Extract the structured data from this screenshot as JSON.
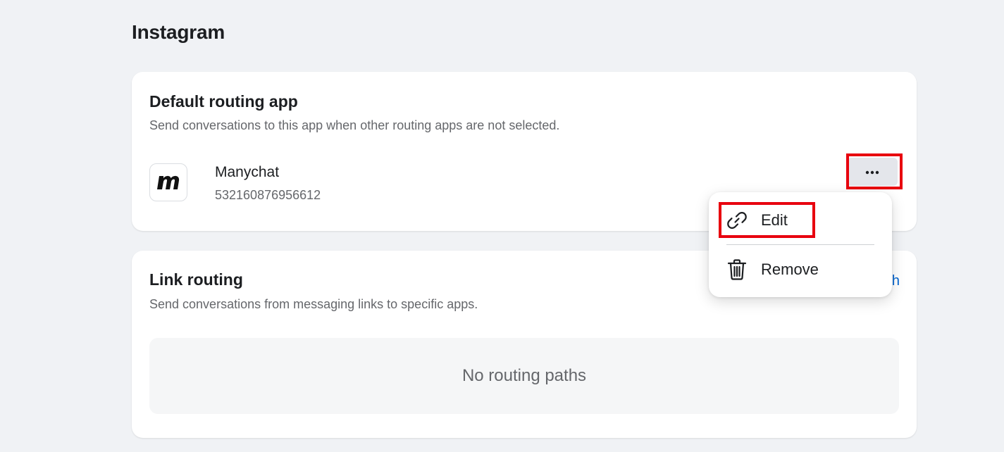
{
  "page": {
    "section_title": "Instagram"
  },
  "default_routing": {
    "title": "Default routing app",
    "description": "Send conversations to this app when other routing apps are not selected.",
    "app": {
      "name": "Manychat",
      "id": "532160876956612",
      "logo_icon": "manychat-logo"
    },
    "more_icon": "ellipsis-icon"
  },
  "link_routing": {
    "title": "Link routing",
    "description": "Send conversations from messaging links to specific apps.",
    "partial_action_label": "h",
    "empty_state": "No routing paths"
  },
  "dropdown_menu": {
    "items": [
      {
        "label": "Edit",
        "icon": "link-icon"
      },
      {
        "label": "Remove",
        "icon": "trash-icon"
      }
    ]
  },
  "colors": {
    "highlight": "#e8000e",
    "link": "#0064d1",
    "background": "#f0f2f5"
  }
}
